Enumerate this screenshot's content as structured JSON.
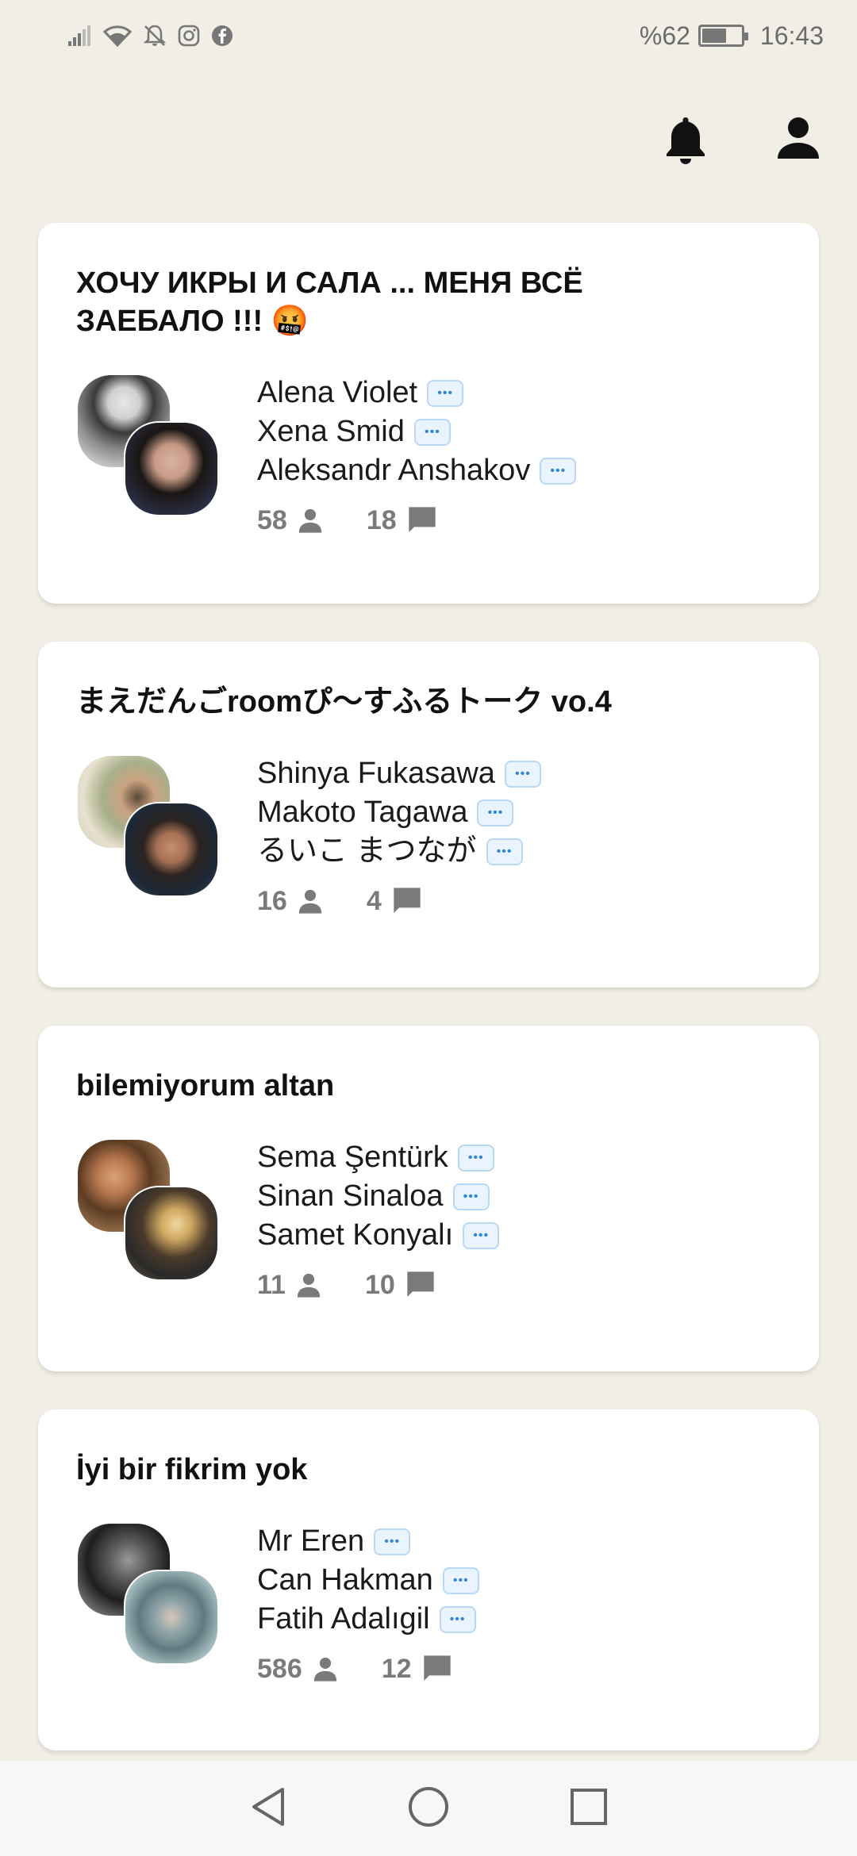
{
  "status_bar": {
    "battery_percent": "%62",
    "battery_level": 0.62,
    "time": "16:43",
    "left_icons": [
      "signal-icon",
      "wifi-icon",
      "notifications-off-icon",
      "instagram-icon",
      "facebook-icon"
    ]
  },
  "top_bar": {
    "icons": [
      "bell-icon",
      "person-icon"
    ]
  },
  "rooms": [
    {
      "title": "ХОЧУ ИКРЫ И САЛА ... МЕНЯ ВСЁ ЗАЕБАЛО !!! 🤬",
      "speakers": [
        "Alena Violet",
        "Xena Smid",
        "Aleksandr Anshakov"
      ],
      "listeners": "58",
      "messages": "18"
    },
    {
      "title": "まえだんごroomぴ〜すふるトーク vo.4",
      "speakers": [
        "Shinya Fukasawa",
        "Makoto Tagawa",
        "るいこ まつなが"
      ],
      "listeners": "16",
      "messages": "4"
    },
    {
      "title": "bilemiyorum altan",
      "speakers": [
        "Sema Şentürk",
        "Sinan Sinaloa",
        "Samet Konyalı"
      ],
      "listeners": "11",
      "messages": "10"
    },
    {
      "title": "İyi bir fikrim yok",
      "speakers": [
        "Mr Eren",
        "Can Hakman",
        "Fatih Adalıgil"
      ],
      "listeners": "586",
      "messages": "12"
    }
  ],
  "nav_bar": {
    "icons": [
      "back-icon",
      "home-icon",
      "recents-icon"
    ]
  }
}
